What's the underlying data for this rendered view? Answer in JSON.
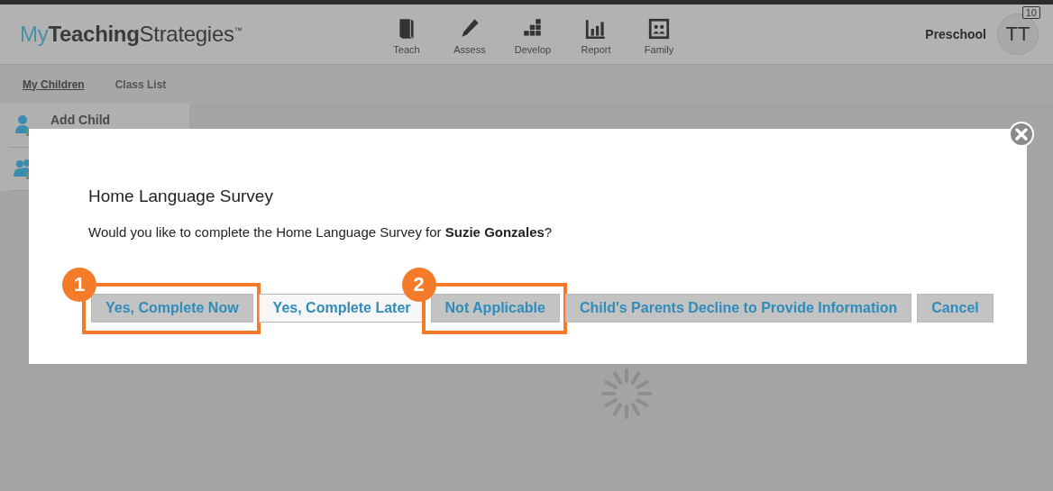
{
  "header": {
    "logo": {
      "my": "My",
      "teaching": "Teaching",
      "strategies": "Strategies",
      "tm": "™"
    },
    "nav": [
      {
        "kind": "book",
        "label": "Teach"
      },
      {
        "kind": "pencil",
        "label": "Assess"
      },
      {
        "kind": "blocks",
        "label": "Develop"
      },
      {
        "kind": "chart",
        "label": "Report"
      },
      {
        "kind": "family",
        "label": "Family"
      }
    ],
    "program": "Preschool",
    "avatar": "TT",
    "badge": "10"
  },
  "subnav": [
    {
      "label": "My Children",
      "selected": true
    },
    {
      "label": "Class List",
      "selected": false
    }
  ],
  "sidebar": {
    "items": [
      {
        "kind": "add-person",
        "label": "Add Child"
      },
      {
        "kind": "add-group"
      }
    ]
  },
  "dialog": {
    "title": "Home Language Survey",
    "message": "Would you like to complete the Home Language Survey for **Suzie Gonzales**?",
    "buttons": [
      {
        "label": "Yes, Complete Now",
        "shaded": true,
        "callout": "1"
      },
      {
        "label": "Yes, Complete Later",
        "shaded": false
      },
      {
        "label": "Not Applicable",
        "shaded": true,
        "callout": "2"
      },
      {
        "label": "Child's Parents Decline to Provide Information",
        "shaded": true
      },
      {
        "label": "Cancel",
        "shaded": true
      }
    ]
  }
}
